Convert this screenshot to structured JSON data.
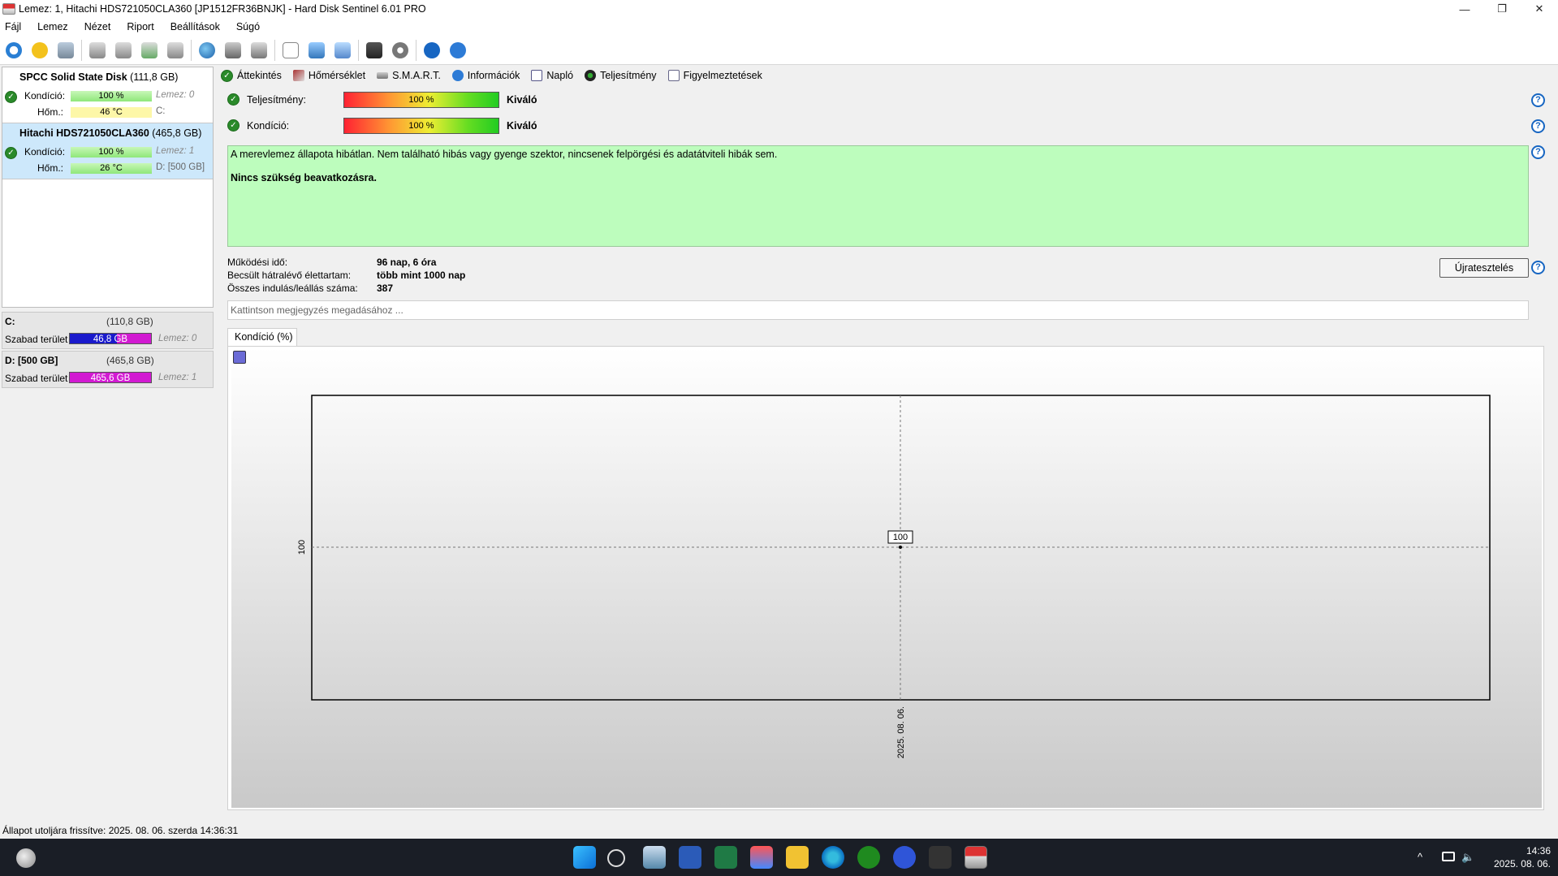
{
  "window": {
    "title": "Lemez: 1, Hitachi HDS721050CLA360 [JP1512FR36BNJK]  -  Hard Disk Sentinel 6.01 PRO"
  },
  "menu": [
    "Fájl",
    "Lemez",
    "Nézet",
    "Riport",
    "Beállítások",
    "Súgó"
  ],
  "disks": [
    {
      "name": "SPCC Solid State Disk",
      "size": "(111,8 GB)",
      "health_label": "Kondíció:",
      "health": "100 %",
      "health_note": "Lemez: 0",
      "temp_label": "Hőm.:",
      "temp": "46 °C",
      "temp_note": "C:"
    },
    {
      "name": "Hitachi HDS721050CLA360",
      "size": "(465,8 GB)",
      "health_label": "Kondíció:",
      "health": "100 %",
      "health_note": "Lemez: 1",
      "temp_label": "Hőm.:",
      "temp": "26 °C",
      "temp_note": "D: [500 GB]"
    }
  ],
  "volumes": [
    {
      "name": "C:",
      "size": "(110,8 GB)",
      "free_label": "Szabad terület",
      "free": "46,8 GB",
      "free_fraction": 0.42,
      "note": "Lemez: 0"
    },
    {
      "name": "D: [500 GB]",
      "size": "(465,8 GB)",
      "free_label": "Szabad terület",
      "free": "465,6 GB",
      "free_fraction": 1.0,
      "note": "Lemez: 1"
    }
  ],
  "tabs": [
    "Áttekintés",
    "Hőmérséklet",
    "S.M.A.R.T.",
    "Információk",
    "Napló",
    "Teljesítmény",
    "Figyelmeztetések"
  ],
  "overview": {
    "perf_label": "Teljesítmény:",
    "perf_value": "100 %",
    "perf_rating": "Kiváló",
    "health_label": "Kondíció:",
    "health_value": "100 %",
    "health_rating": "Kiváló",
    "status_text": "A merevlemez állapota hibátlan. Nem található hibás vagy gyenge szektor, nincsenek felpörgési és adatátviteli hibák sem.",
    "status_action": "Nincs szükség beavatkozásra.",
    "uptime_label": "Működési idő:",
    "uptime": "96 nap, 6 óra",
    "lifetime_label": "Becsült hátralévő élettartam:",
    "lifetime": "több mint 1000 nap",
    "starts_label": "Összes indulás/leállás száma:",
    "starts": "387",
    "retest_button": "Újratesztelés",
    "memo_placeholder": "Kattintson megjegyzés megadásához ..."
  },
  "chart_tab": "Kondíció  (%)",
  "chart_data": {
    "type": "line",
    "x": [
      "2025. 08. 06."
    ],
    "series": [
      {
        "values": [
          100
        ]
      }
    ],
    "y_tick": "100",
    "point_label": "100",
    "x_tick": "2025. 08. 06."
  },
  "statusbar": "Állapot utoljára frissítve: 2025. 08. 06. szerda 14:36:31",
  "clock": {
    "time": "14:36",
    "date": "2025. 08. 06."
  }
}
